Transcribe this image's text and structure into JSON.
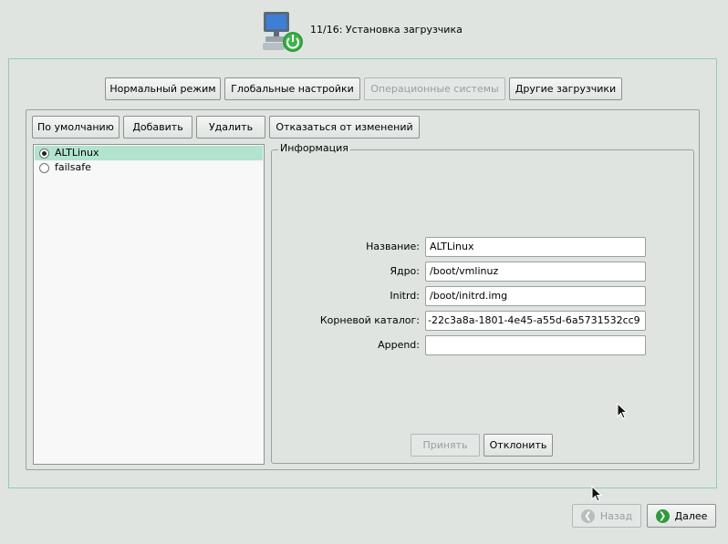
{
  "header": {
    "title": "11/16: Установка загрузчика"
  },
  "top_tabs": {
    "normal": "Нормальный режим",
    "global": "Глобальные настройки",
    "os": "Операционные системы",
    "other": "Другие загрузчики"
  },
  "toolbar": {
    "default": "По умолчанию",
    "add": "Добавить",
    "remove": "Удалить",
    "revert": "Отказаться от изменений"
  },
  "entries": [
    {
      "label": "ALTLinux",
      "selected": true
    },
    {
      "label": "failsafe",
      "selected": false
    }
  ],
  "info": {
    "legend": "Информация",
    "name_label": "Название:",
    "name_value": "ALTLinux",
    "kernel_label": "Ядро:",
    "kernel_value": "/boot/vmlinuz",
    "initrd_label": "Initrd:",
    "initrd_value": "/boot/initrd.img",
    "root_label": "Корневой каталог:",
    "root_value": "-22c3a8a-1801-4e45-a55d-6a5731532cc9",
    "append_label": "Append:",
    "append_value": "",
    "apply": "Принять",
    "reject": "Отклонить"
  },
  "footer": {
    "back": "Назад",
    "next": "Далее"
  },
  "colors": {
    "accent_green": "#2e9b3a",
    "selection": "#b1e3cf",
    "frame": "#8fcfae"
  }
}
